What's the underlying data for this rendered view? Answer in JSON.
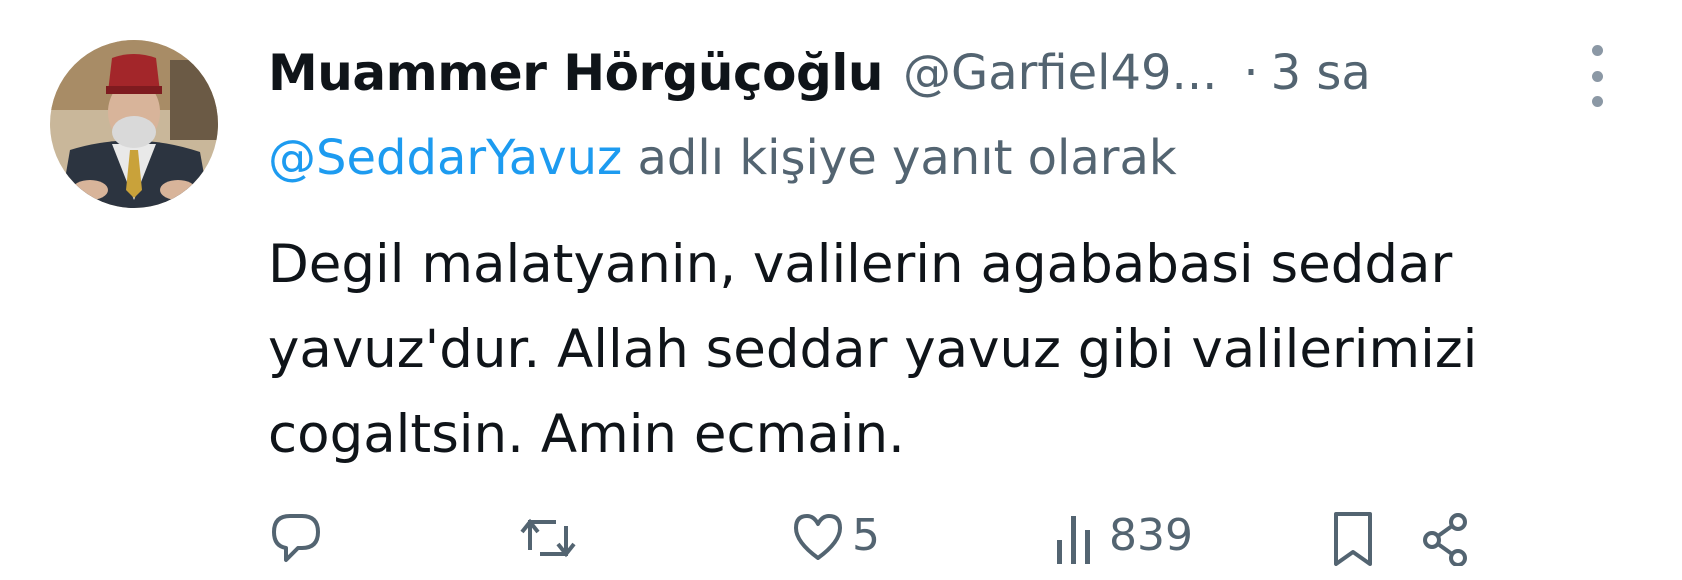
{
  "tweet": {
    "author_name": "Muammer Hörgüçoğlu",
    "author_handle": "@Garfiel49...",
    "separator": "·",
    "time": "3 sa",
    "reply_to_mention": "@SeddarYavuz",
    "reply_to_suffix": "adlı kişiye yanıt olarak",
    "text_lines": [
      "Degil malatyanin, valilerin agababasi seddar",
      "yavuz'dur. Allah seddar yavuz gibi valilerimizi",
      "cogaltsin. Amin ecmain."
    ]
  },
  "actions": {
    "likes_count": "5",
    "views_count": "839"
  },
  "icons": [
    "more-vertical-icon",
    "reply-icon",
    "retweet-icon",
    "like-icon",
    "views-icon",
    "bookmark-icon",
    "share-icon"
  ],
  "colors": {
    "mention": "#1d9bf0",
    "secondary_text": "#536471",
    "primary_text": "#0f1419"
  }
}
